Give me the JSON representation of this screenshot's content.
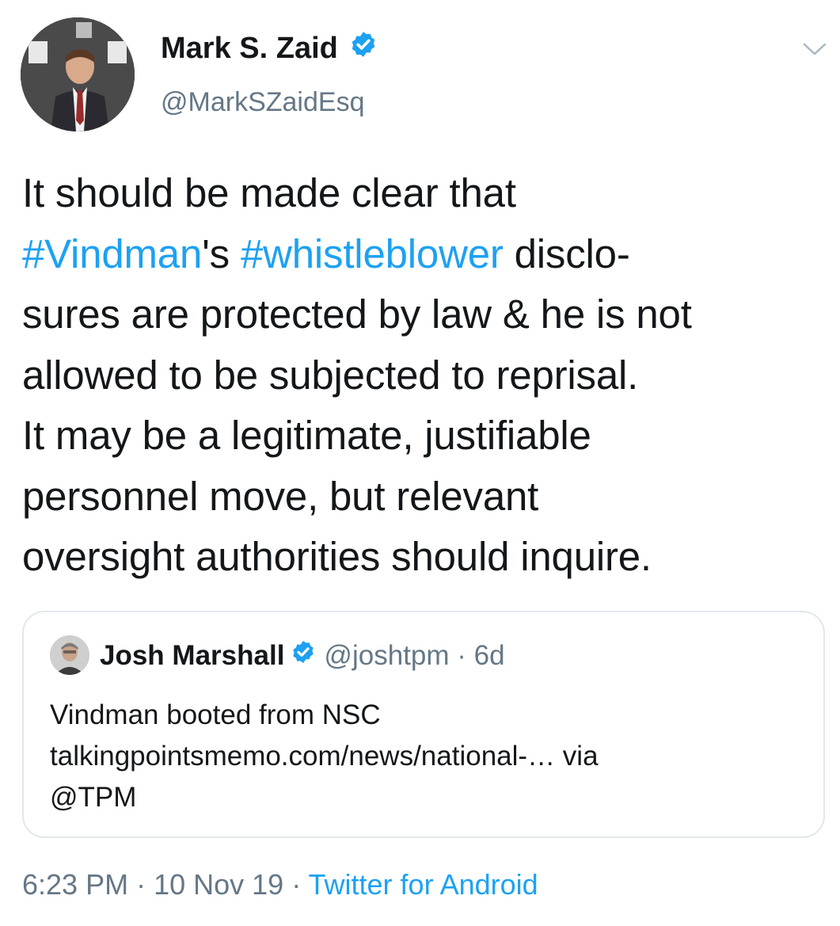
{
  "tweet": {
    "author": {
      "name": "Mark S. Zaid",
      "handle": "@MarkSZaidEsq",
      "verified": true
    },
    "body": {
      "line1": "It should be made clear that",
      "hashtag1": "#Vindman",
      "mid": "'s ",
      "hashtag2": "#whistleblower",
      "tail": " disclo-",
      "line3": "sures are protected by law & he is not",
      "line4": "allowed to be subjected to reprisal.",
      "line5": "It may be a legitimate, justifiable",
      "line6": "personnel move, but relevant",
      "line7": "oversight authorities should inquire."
    },
    "quoted": {
      "name": "Josh Marshall",
      "handle": "@joshtpm",
      "separator": " · ",
      "age": "6d",
      "line1": "Vindman booted from NSC",
      "line2": "talkingpointsmemo.com/news/national-… via",
      "line3": "@TPM"
    },
    "footer": {
      "time": "6:23 PM",
      "separator1": " · ",
      "date": "10 Nov 19",
      "separator2": " · ",
      "source": "Twitter for Android"
    }
  },
  "icons": {
    "verified": "verified-badge-icon",
    "menu": "chevron-down-icon"
  },
  "colors": {
    "link": "#1da1f2",
    "secondary_text": "#657786",
    "border": "#e1e8ed",
    "text": "#14171a"
  }
}
